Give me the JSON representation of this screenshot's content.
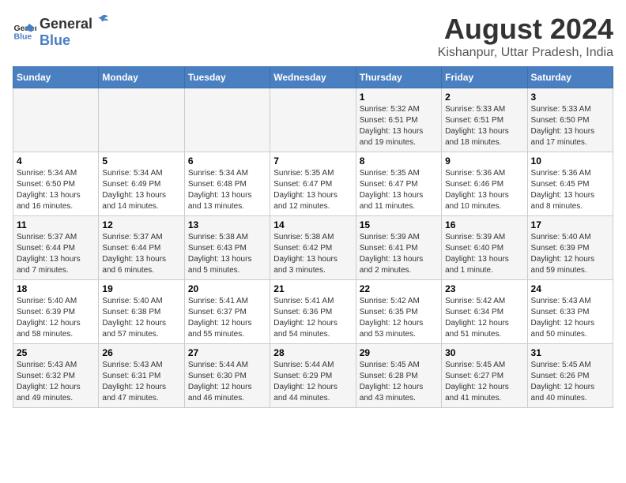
{
  "logo": {
    "general": "General",
    "blue": "Blue"
  },
  "title": "August 2024",
  "subtitle": "Kishanpur, Uttar Pradesh, India",
  "days_of_week": [
    "Sunday",
    "Monday",
    "Tuesday",
    "Wednesday",
    "Thursday",
    "Friday",
    "Saturday"
  ],
  "weeks": [
    [
      {
        "num": "",
        "info": ""
      },
      {
        "num": "",
        "info": ""
      },
      {
        "num": "",
        "info": ""
      },
      {
        "num": "",
        "info": ""
      },
      {
        "num": "1",
        "info": "Sunrise: 5:32 AM\nSunset: 6:51 PM\nDaylight: 13 hours and 19 minutes."
      },
      {
        "num": "2",
        "info": "Sunrise: 5:33 AM\nSunset: 6:51 PM\nDaylight: 13 hours and 18 minutes."
      },
      {
        "num": "3",
        "info": "Sunrise: 5:33 AM\nSunset: 6:50 PM\nDaylight: 13 hours and 17 minutes."
      }
    ],
    [
      {
        "num": "4",
        "info": "Sunrise: 5:34 AM\nSunset: 6:50 PM\nDaylight: 13 hours and 16 minutes."
      },
      {
        "num": "5",
        "info": "Sunrise: 5:34 AM\nSunset: 6:49 PM\nDaylight: 13 hours and 14 minutes."
      },
      {
        "num": "6",
        "info": "Sunrise: 5:34 AM\nSunset: 6:48 PM\nDaylight: 13 hours and 13 minutes."
      },
      {
        "num": "7",
        "info": "Sunrise: 5:35 AM\nSunset: 6:47 PM\nDaylight: 13 hours and 12 minutes."
      },
      {
        "num": "8",
        "info": "Sunrise: 5:35 AM\nSunset: 6:47 PM\nDaylight: 13 hours and 11 minutes."
      },
      {
        "num": "9",
        "info": "Sunrise: 5:36 AM\nSunset: 6:46 PM\nDaylight: 13 hours and 10 minutes."
      },
      {
        "num": "10",
        "info": "Sunrise: 5:36 AM\nSunset: 6:45 PM\nDaylight: 13 hours and 8 minutes."
      }
    ],
    [
      {
        "num": "11",
        "info": "Sunrise: 5:37 AM\nSunset: 6:44 PM\nDaylight: 13 hours and 7 minutes."
      },
      {
        "num": "12",
        "info": "Sunrise: 5:37 AM\nSunset: 6:44 PM\nDaylight: 13 hours and 6 minutes."
      },
      {
        "num": "13",
        "info": "Sunrise: 5:38 AM\nSunset: 6:43 PM\nDaylight: 13 hours and 5 minutes."
      },
      {
        "num": "14",
        "info": "Sunrise: 5:38 AM\nSunset: 6:42 PM\nDaylight: 13 hours and 3 minutes."
      },
      {
        "num": "15",
        "info": "Sunrise: 5:39 AM\nSunset: 6:41 PM\nDaylight: 13 hours and 2 minutes."
      },
      {
        "num": "16",
        "info": "Sunrise: 5:39 AM\nSunset: 6:40 PM\nDaylight: 13 hours and 1 minute."
      },
      {
        "num": "17",
        "info": "Sunrise: 5:40 AM\nSunset: 6:39 PM\nDaylight: 12 hours and 59 minutes."
      }
    ],
    [
      {
        "num": "18",
        "info": "Sunrise: 5:40 AM\nSunset: 6:39 PM\nDaylight: 12 hours and 58 minutes."
      },
      {
        "num": "19",
        "info": "Sunrise: 5:40 AM\nSunset: 6:38 PM\nDaylight: 12 hours and 57 minutes."
      },
      {
        "num": "20",
        "info": "Sunrise: 5:41 AM\nSunset: 6:37 PM\nDaylight: 12 hours and 55 minutes."
      },
      {
        "num": "21",
        "info": "Sunrise: 5:41 AM\nSunset: 6:36 PM\nDaylight: 12 hours and 54 minutes."
      },
      {
        "num": "22",
        "info": "Sunrise: 5:42 AM\nSunset: 6:35 PM\nDaylight: 12 hours and 53 minutes."
      },
      {
        "num": "23",
        "info": "Sunrise: 5:42 AM\nSunset: 6:34 PM\nDaylight: 12 hours and 51 minutes."
      },
      {
        "num": "24",
        "info": "Sunrise: 5:43 AM\nSunset: 6:33 PM\nDaylight: 12 hours and 50 minutes."
      }
    ],
    [
      {
        "num": "25",
        "info": "Sunrise: 5:43 AM\nSunset: 6:32 PM\nDaylight: 12 hours and 49 minutes."
      },
      {
        "num": "26",
        "info": "Sunrise: 5:43 AM\nSunset: 6:31 PM\nDaylight: 12 hours and 47 minutes."
      },
      {
        "num": "27",
        "info": "Sunrise: 5:44 AM\nSunset: 6:30 PM\nDaylight: 12 hours and 46 minutes."
      },
      {
        "num": "28",
        "info": "Sunrise: 5:44 AM\nSunset: 6:29 PM\nDaylight: 12 hours and 44 minutes."
      },
      {
        "num": "29",
        "info": "Sunrise: 5:45 AM\nSunset: 6:28 PM\nDaylight: 12 hours and 43 minutes."
      },
      {
        "num": "30",
        "info": "Sunrise: 5:45 AM\nSunset: 6:27 PM\nDaylight: 12 hours and 41 minutes."
      },
      {
        "num": "31",
        "info": "Sunrise: 5:45 AM\nSunset: 6:26 PM\nDaylight: 12 hours and 40 minutes."
      }
    ]
  ]
}
